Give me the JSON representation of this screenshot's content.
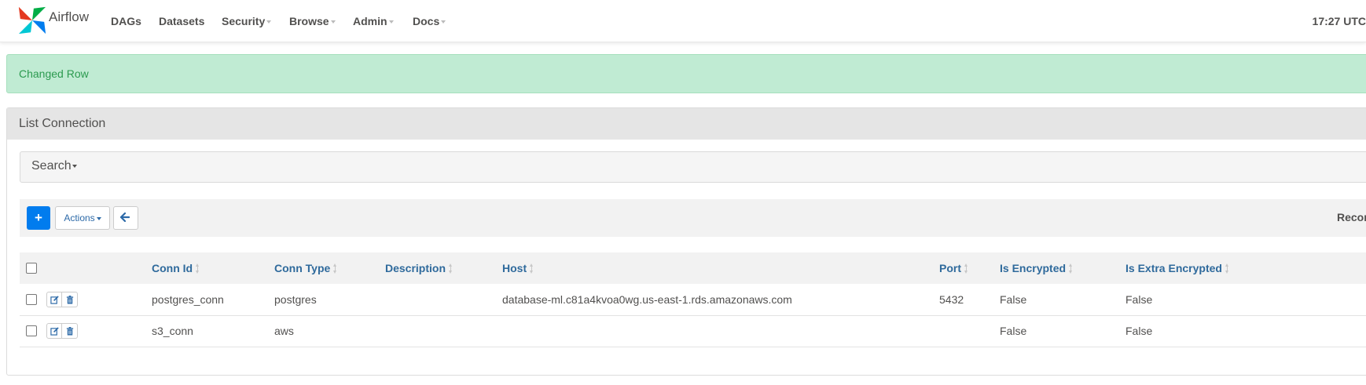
{
  "navbar": {
    "brand": "Airflow",
    "items": [
      {
        "label": "DAGs",
        "dropdown": false
      },
      {
        "label": "Datasets",
        "dropdown": false
      },
      {
        "label": "Security",
        "dropdown": true
      },
      {
        "label": "Browse",
        "dropdown": true
      },
      {
        "label": "Admin",
        "dropdown": true
      },
      {
        "label": "Docs",
        "dropdown": true
      }
    ],
    "clock": "17:27 UTC"
  },
  "alert": {
    "message": "Changed Row",
    "type": "success"
  },
  "panel": {
    "title": "List Connection",
    "search_label": "Search",
    "actions_label": "Actions",
    "add_icon": "plus-icon",
    "back_icon": "arrow-left-icon",
    "records_label": "Recor"
  },
  "table": {
    "columns": [
      "Conn Id",
      "Conn Type",
      "Description",
      "Host",
      "Port",
      "Is Encrypted",
      "Is Extra Encrypted"
    ],
    "rows": [
      {
        "conn_id": "postgres_conn",
        "conn_type": "postgres",
        "description": "",
        "host": "database-ml.c81a4kvoa0wg.us-east-1.rds.amazonaws.com",
        "port": "5432",
        "is_encrypted": "False",
        "is_extra_encrypted": "False"
      },
      {
        "conn_id": "s3_conn",
        "conn_type": "aws",
        "description": "",
        "host": "",
        "port": "",
        "is_encrypted": "False",
        "is_extra_encrypted": "False"
      }
    ]
  },
  "colors": {
    "accent": "#017cee",
    "header_link": "#2f6a9c",
    "alert_bg": "#c0ebd3",
    "alert_text": "#2b9a4f"
  }
}
